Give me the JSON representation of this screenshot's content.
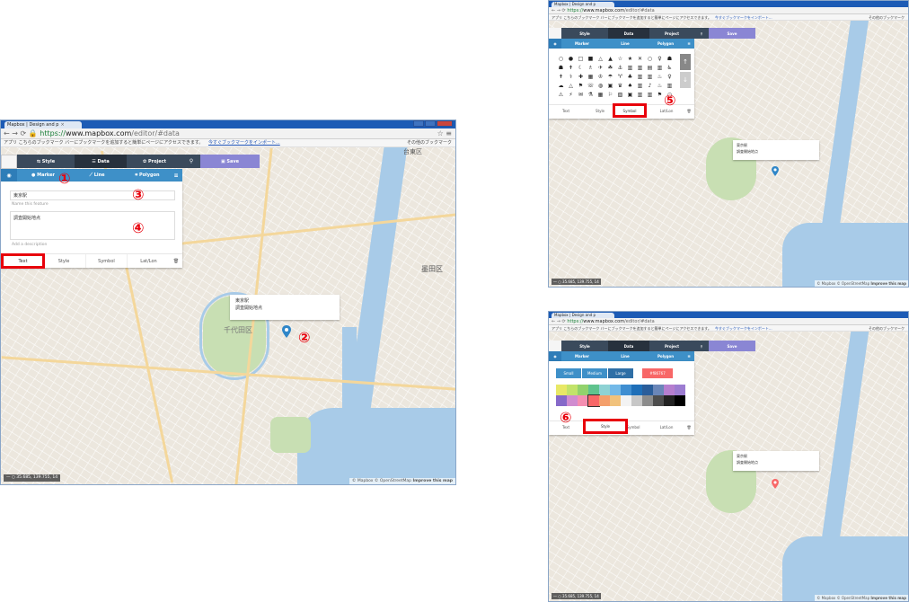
{
  "browser": {
    "tab_title": "Mapbox | Design and p",
    "tab_close": "×",
    "url_prefix": "https://",
    "url_host": "www.mapbox.com",
    "url_path": "/editor/#data",
    "url_path_right": "/editor/#data",
    "bookmark_prefix": "アプリ",
    "bookmark_text": "こちらのブックマーク バーにブックマークを追加すると簡単にページにアクセスできます。",
    "bookmark_link": "今すぐブックマークをインポート...",
    "bookmark_other": "その他のブックマーク"
  },
  "toolbar": {
    "style": "Style",
    "data": "Data",
    "project": "Project",
    "save": "Save",
    "marker": "Marker",
    "line": "Line",
    "polygon": "Polygon",
    "search_icon": "search-icon",
    "menu_icon": "menu-icon"
  },
  "panel_main": {
    "name_value": "東京駅",
    "name_hint": "Name this feature",
    "desc_value": "調査開始地点",
    "desc_hint": "Add a description",
    "tabs": [
      "Text",
      "Style",
      "Symbol",
      "Lat/Lon"
    ]
  },
  "panel_style": {
    "sizes": [
      "Small",
      "Medium",
      "Large"
    ],
    "selected_size": "Large",
    "hex_value": "#f86767",
    "colors": [
      "#e8e866",
      "#c2e36a",
      "#92d26d",
      "#5fc38e",
      "#8ed2d4",
      "#73b9e8",
      "#3f8ed1",
      "#1f6fb8",
      "#2a5d9a",
      "#6a86b8",
      "#b57ecf",
      "#9c7cd1",
      "#8669c9",
      "#d08cd0",
      "#f58fb2",
      "#f86767",
      "#f49f6b",
      "#f1c27c",
      "#f3f3f3",
      "#c7c7c7",
      "#8c8c8c",
      "#4d4d4d",
      "#222222",
      "#000000"
    ]
  },
  "popup": {
    "title": "東京駅",
    "body": "調査開始地点"
  },
  "annotations": [
    "①",
    "②",
    "③",
    "④",
    "⑤",
    "⑥"
  ],
  "map": {
    "ward_label": "墨田区",
    "ward_label2": "台東区",
    "district_label": "千代田区",
    "scale_text": "35.685, 139.755, 14",
    "attribution_mapbox": "© Mapbox",
    "attribution_osm": "© OpenStreetMap",
    "attribution_improve": "Improve this map"
  },
  "colors": {
    "nav_dark": "#3a4a5c",
    "nav_blue": "#3e90c8",
    "save_purple": "#8a86d4",
    "marker_blue": "#2f86c8",
    "marker_red": "#f86767",
    "annotation_red": "#e8000b"
  }
}
